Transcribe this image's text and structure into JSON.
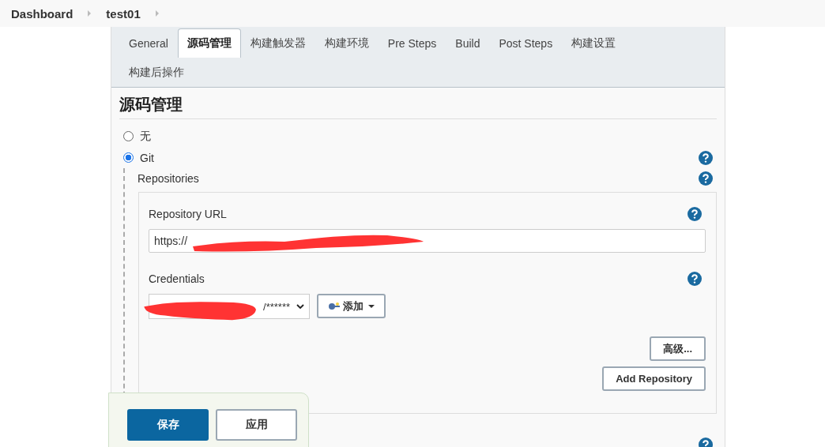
{
  "breadcrumbs": [
    "Dashboard",
    "test01"
  ],
  "tabs": [
    {
      "label": "General",
      "selected": false
    },
    {
      "label": "源码管理",
      "selected": true
    },
    {
      "label": "构建触发器",
      "selected": false
    },
    {
      "label": "构建环境",
      "selected": false
    },
    {
      "label": "Pre Steps",
      "selected": false
    },
    {
      "label": "Build",
      "selected": false
    },
    {
      "label": "Post Steps",
      "selected": false
    },
    {
      "label": "构建设置",
      "selected": false
    },
    {
      "label": "构建后操作",
      "selected": false
    }
  ],
  "section_title": "源码管理",
  "scm_options": [
    {
      "label": "无",
      "selected": false
    },
    {
      "label": "Git",
      "selected": true
    }
  ],
  "repositories": {
    "label": "Repositories",
    "url_label": "Repository URL",
    "url_value": "https://",
    "credentials_label": "Credentials",
    "credentials_value": "/******",
    "add_button": "添加",
    "advanced_button": "高级...",
    "add_repository_button": "Add Repository"
  },
  "save_bar": {
    "save": "保存",
    "apply": "应用"
  }
}
